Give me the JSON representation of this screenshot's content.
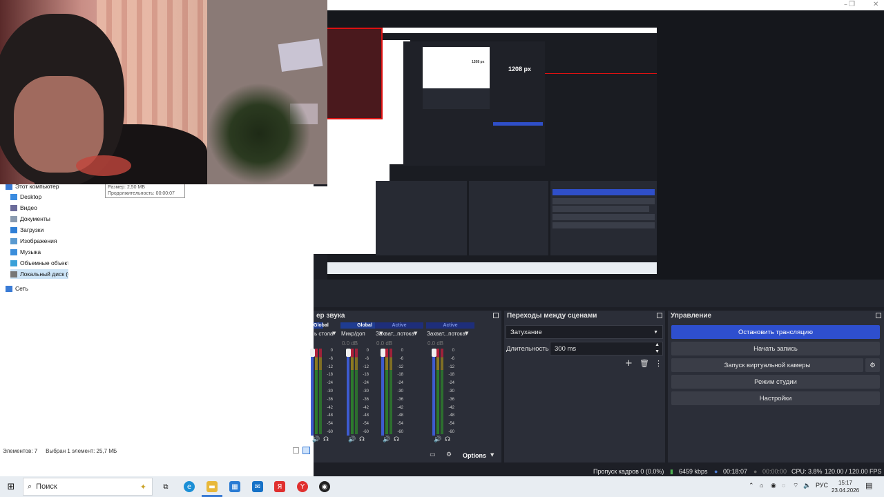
{
  "webcam": {},
  "explorer": {
    "nav": [
      {
        "label": "Этот компьютер",
        "icon": "computer-icon",
        "color": "#3a7bd5"
      },
      {
        "label": "Desktop",
        "icon": "desktop-folder-icon",
        "color": "#3a8be0"
      },
      {
        "label": "Видео",
        "icon": "video-folder-icon",
        "color": "#6b6b9a"
      },
      {
        "label": "Документы",
        "icon": "documents-folder-icon",
        "color": "#8a9bb0"
      },
      {
        "label": "Загрузки",
        "icon": "downloads-folder-icon",
        "color": "#2f7fd6"
      },
      {
        "label": "Изображения",
        "icon": "pictures-folder-icon",
        "color": "#5a9ad0"
      },
      {
        "label": "Музыка",
        "icon": "music-folder-icon",
        "color": "#3b8edb"
      },
      {
        "label": "Объемные объекты",
        "icon": "3d-objects-icon",
        "color": "#39a0d8"
      },
      {
        "label": "Локальный диск (C",
        "icon": "drive-icon",
        "color": "#777"
      },
      {
        "label": "Сеть",
        "icon": "network-icon",
        "color": "#3a7bd5"
      }
    ],
    "tooltip": {
      "size": "Размер: 2,50 МБ",
      "duration": "Продолжительность: 00:00:07"
    },
    "status": {
      "count": "Элементов: 7",
      "selected": "Выбран 1 элемент: 25,7 МБ"
    }
  },
  "capture": {
    "px_label_big": "1208 px",
    "px_label_small": "1208 px"
  },
  "mixer": {
    "title": "ер звука",
    "channels": [
      {
        "head": "Global",
        "name": "ь стола",
        "db": "",
        "active": false
      },
      {
        "head": "Global",
        "name": "Микр/доп",
        "db": "0.0 dB",
        "active": false
      },
      {
        "head": "Active",
        "name": "Захват...потока",
        "db": "0.0 dB",
        "active": true
      },
      {
        "head": "Active",
        "name": "Захват...потока",
        "db": "0.0 dB",
        "active": true
      }
    ],
    "scale": [
      "0",
      "-6",
      "-12",
      "-18",
      "-24",
      "-30",
      "-36",
      "-42",
      "-48",
      "-54",
      "-60"
    ],
    "options_label": "Options"
  },
  "transitions": {
    "title": "Переходы между сценами",
    "selected": "Затухание",
    "duration_label": "Длительность",
    "duration_value": "300 ms"
  },
  "controls": {
    "title": "Управление",
    "stop_stream": "Остановить трансляцию",
    "start_record": "Начать запись",
    "virtual_cam": "Запуск виртуальной камеры",
    "studio_mode": "Режим студии",
    "settings": "Настройки"
  },
  "status": {
    "dropped": "Пропуск кадров 0 (0.0%)",
    "bitrate": "6459 kbps",
    "stream_time": "00:18:07",
    "rec_time": "00:00:00",
    "cpu": "CPU: 3.8%",
    "fps": "120.00 / 120.00 FPS"
  },
  "taskbar": {
    "search_placeholder": "Поиск",
    "lang": "РУС",
    "time": "15:17",
    "date": "23.04.2026"
  },
  "colors": {
    "accent": "#2e4fce",
    "obs_bg": "#1d1f26",
    "dock_bg": "#2b2e38",
    "meter_green": "#2d7a2d",
    "capture_red": "#dd1111"
  }
}
